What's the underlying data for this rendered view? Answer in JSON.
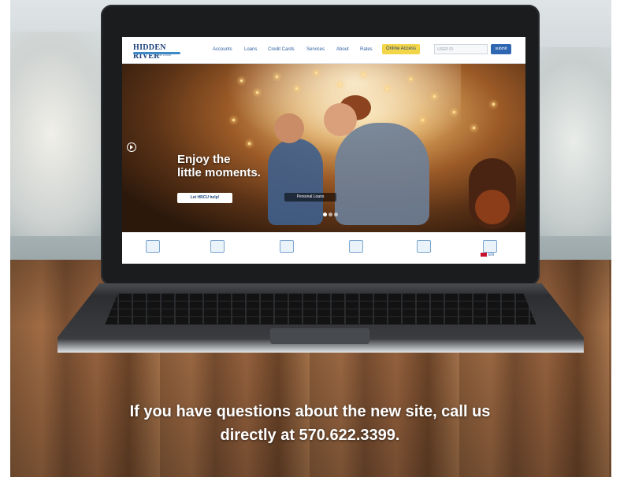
{
  "site": {
    "logo_main": "HIDDEN RIVER",
    "logo_sub": "Credit Union",
    "nav": [
      "Accounts",
      "Loans",
      "Credit Cards",
      "Services",
      "About",
      "Rates"
    ],
    "online_access": "Online Access",
    "login_placeholder": "USER ID",
    "submit_label": "submit",
    "hero": {
      "headline_line1": "Enjoy the",
      "headline_line2": "little moments.",
      "cta_label": "Let HRCU help!",
      "slide_label": "Personal Loans"
    },
    "language_label": "EN",
    "icons": [
      "house-icon",
      "car-icon",
      "credit-card-icon",
      "calculator-icon",
      "chart-icon",
      "document-icon"
    ]
  },
  "caption": {
    "line1": "If you have questions about the new site, call us",
    "line2": "directly at 570.622.3399."
  },
  "colors": {
    "brand_blue": "#1d3f7a",
    "link_blue": "#2d5ea0",
    "online_yellow": "#f3d54a",
    "submit_blue": "#2e66b1"
  }
}
